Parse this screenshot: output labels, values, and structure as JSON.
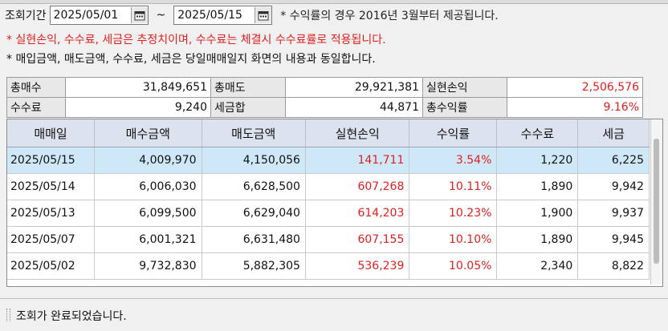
{
  "filter": {
    "label": "조회기간",
    "start_date": "2025/05/01",
    "end_date": "2025/05/15",
    "separator": "~",
    "notice": "* 수익률의 경우 2016년 3월부터 제공됩니다."
  },
  "notes": [
    "* 실현손익, 수수료, 세금은 추정치이며, 수수료는 체결시 수수료률로 적용됩니다.",
    "* 매입금액, 매도금액, 수수료, 세금은 당일매매일지 화면의 내용과 동일합니다."
  ],
  "summary": {
    "total_buy_label": "총매수",
    "total_buy": "31,849,651",
    "total_sell_label": "총매도",
    "total_sell": "29,921,381",
    "realized_label": "실현손익",
    "realized": "2,506,576",
    "fee_label": "수수료",
    "fee": "9,240",
    "tax_label": "세금합",
    "tax": "44,871",
    "return_label": "총수익률",
    "return": "9.16%"
  },
  "table": {
    "headers": [
      "매매일",
      "매수금액",
      "매도금액",
      "실현손익",
      "수익률",
      "수수료",
      "세금"
    ],
    "rows": [
      [
        "2025/05/15",
        "4,009,970",
        "4,150,056",
        "141,711",
        "3.54%",
        "1,220",
        "6,225"
      ],
      [
        "2025/05/14",
        "6,006,030",
        "6,628,500",
        "607,268",
        "10.11%",
        "1,890",
        "9,942"
      ],
      [
        "2025/05/13",
        "6,099,500",
        "6,629,040",
        "614,203",
        "10.23%",
        "1,900",
        "9,937"
      ],
      [
        "2025/05/07",
        "6,001,321",
        "6,631,480",
        "607,155",
        "10.10%",
        "1,890",
        "9,945"
      ],
      [
        "2025/05/02",
        "9,732,830",
        "5,882,305",
        "536,239",
        "10.05%",
        "2,340",
        "8,822"
      ]
    ]
  },
  "status": {
    "message": "조회가 완료되었습니다."
  },
  "colors": {
    "positive": "#e02020",
    "selected_row": "#cfe8f8",
    "header_bg": "#dde3ee"
  },
  "icons": {
    "calendar": "calendar-icon"
  }
}
